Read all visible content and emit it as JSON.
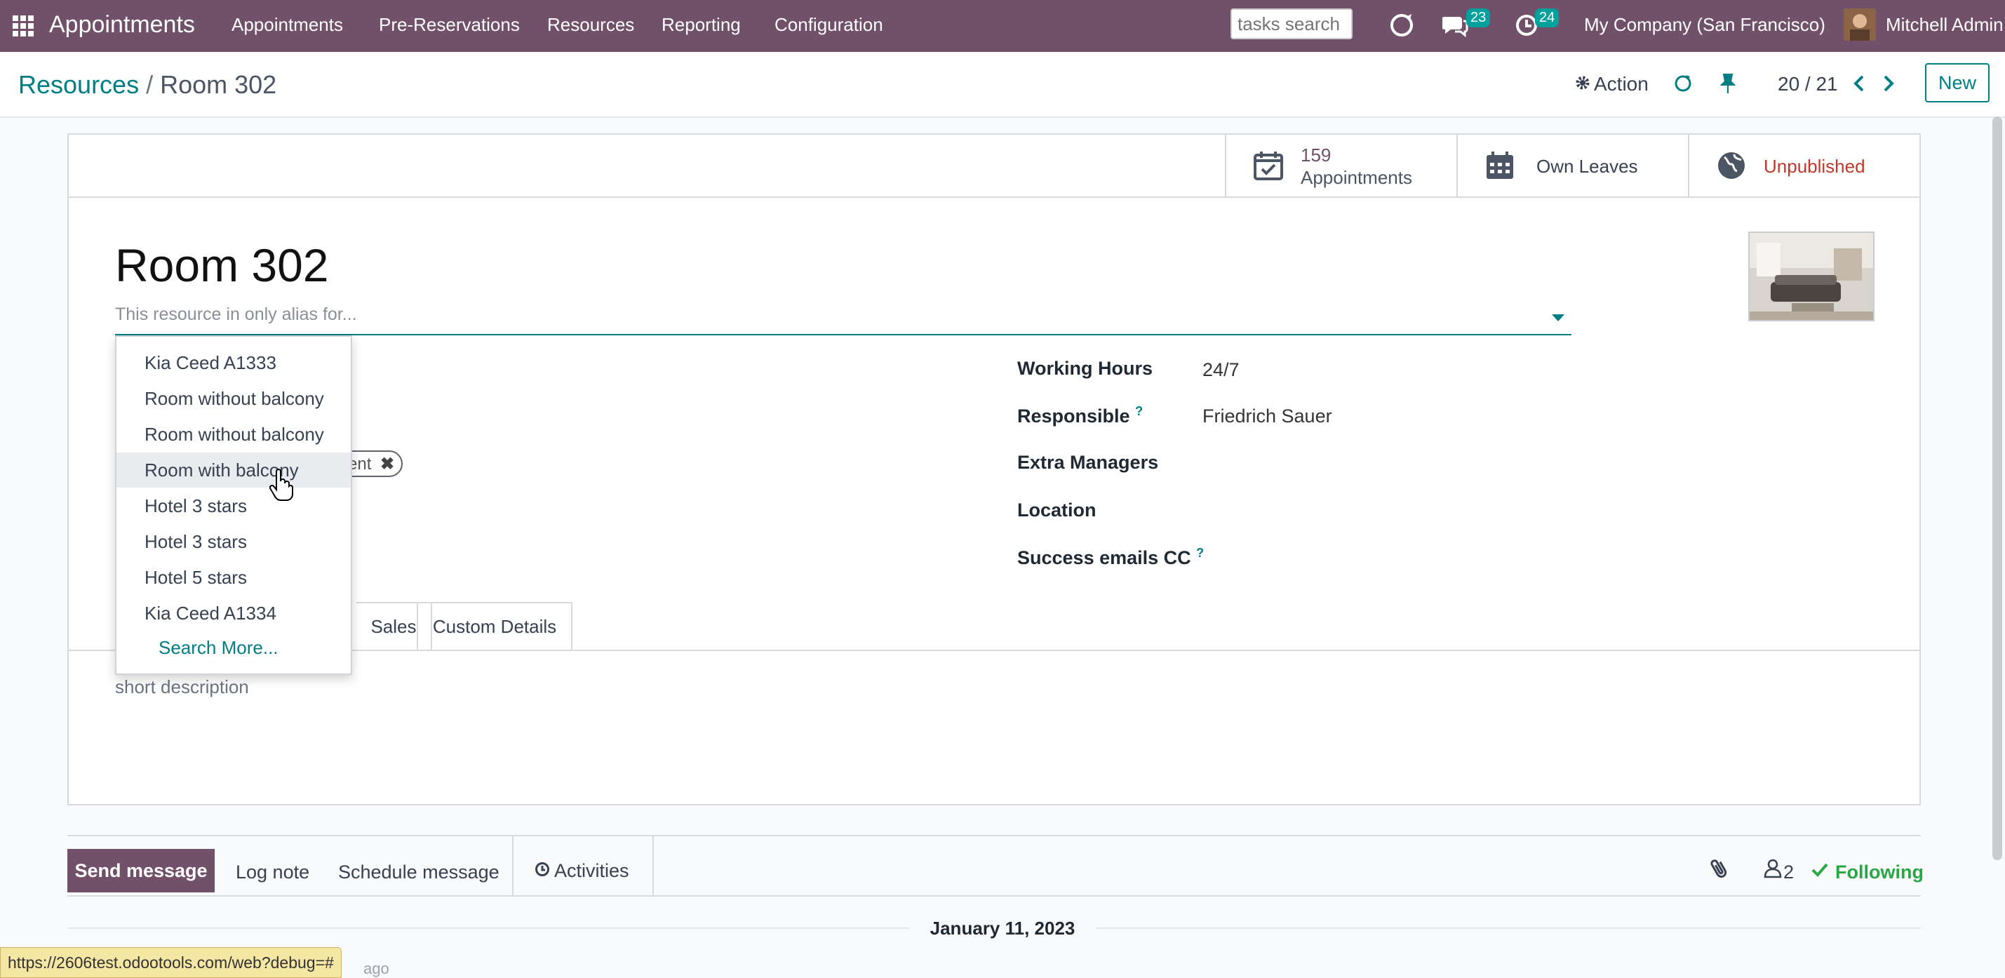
{
  "navbar": {
    "app_title": "Appointments",
    "menu": [
      "Appointments",
      "Pre-Reservations",
      "Resources",
      "Reporting",
      "Configuration"
    ],
    "search_placeholder": "tasks search",
    "messages_count": "23",
    "activities_count": "24",
    "company": "My Company (San Francisco)",
    "user": "Mitchell Admin",
    "color": "#71506a"
  },
  "control_panel": {
    "breadcrumb_parent": "Resources",
    "breadcrumb_sep": "/",
    "breadcrumb_current": "Room 302",
    "action_label": "Action",
    "pager": "20 / 21",
    "new_label": "New"
  },
  "stat_buttons": {
    "appointments_count": "159",
    "appointments_label": "Appointments",
    "leaves_label": "Own Leaves",
    "publish_label": "Unpublished"
  },
  "form": {
    "name": "Room 302",
    "alias_placeholder": "This resource in only alias for...",
    "fields": [
      {
        "label": "Working Hours",
        "value": "24/7"
      },
      {
        "label": "Responsible",
        "value": "Friedrich Sauer",
        "help": "?"
      },
      {
        "label": "Extra Managers",
        "value": ""
      },
      {
        "label": "Location",
        "value": ""
      },
      {
        "label": "Success emails CC",
        "value": "",
        "help": "?"
      }
    ],
    "tag_partial": "ent",
    "tabs": [
      "Sales",
      "Custom Details"
    ],
    "short_description": "short description"
  },
  "dropdown": {
    "items": [
      "Kia Ceed A1333",
      "Room without balcony",
      "Room without balcony",
      "Room with balcony",
      "Hotel 3 stars",
      "Hotel 3 stars",
      "Hotel 5 stars",
      "Kia Ceed A1334"
    ],
    "search_more": "Search More..."
  },
  "chatter": {
    "send_message": "Send message",
    "log_note": "Log note",
    "schedule_message": "Schedule message",
    "activities": "Activities",
    "followers_count": "2",
    "following": "Following",
    "date_separator": "January 11, 2023",
    "ago": "ago"
  },
  "status_url": "https://2606test.odootools.com/web?debug=#"
}
